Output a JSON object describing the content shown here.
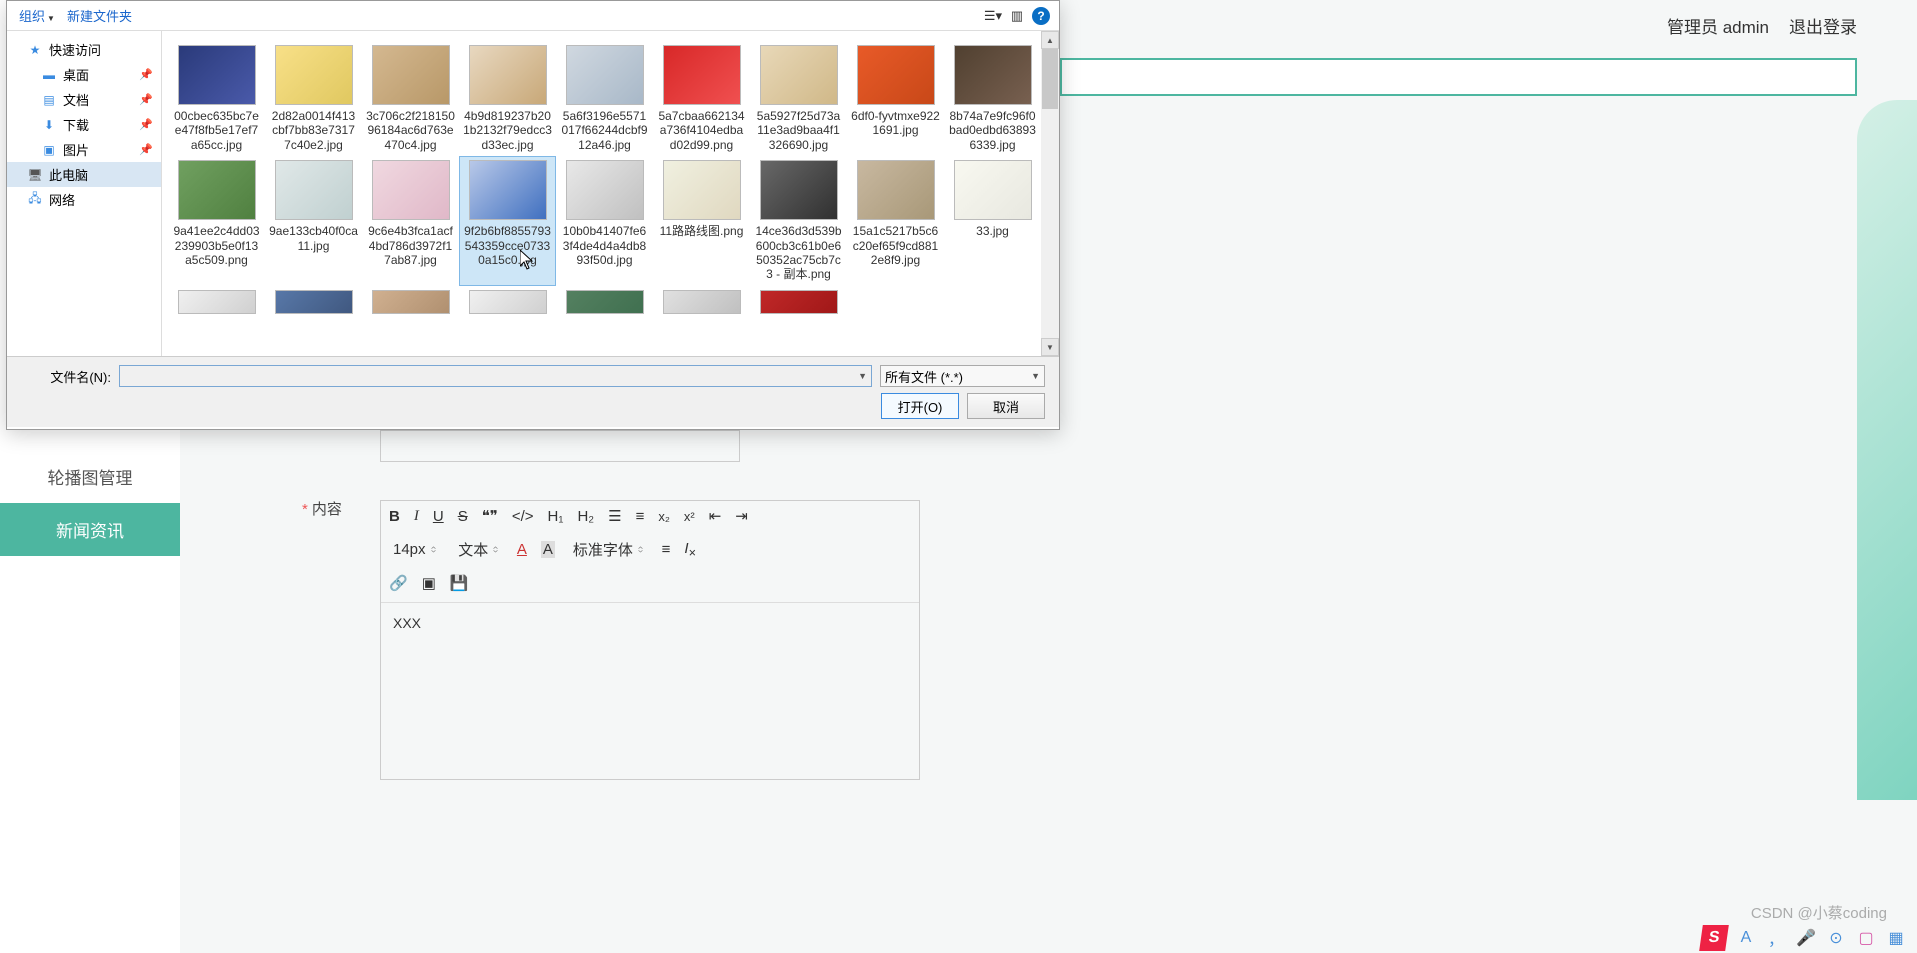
{
  "bg": {
    "admin_label": "管理员 admin",
    "logout": "退出登录",
    "sidebar": {
      "carousel": "轮播图管理",
      "news": "新闻资讯"
    },
    "content_label": "内容",
    "editor": {
      "fontsize": "14px",
      "text_type": "文本",
      "font_family": "标准字体",
      "body_text": "XXX"
    }
  },
  "dialog": {
    "organize": "组织",
    "new_folder": "新建文件夹",
    "filename_label": "文件名(N):",
    "filename_value": "",
    "filetype": "所有文件 (*.*)",
    "open_btn": "打开(O)",
    "cancel_btn": "取消",
    "sidebar": {
      "quick_access": "快速访问",
      "desktop": "桌面",
      "documents": "文档",
      "downloads": "下载",
      "pictures": "图片",
      "this_pc": "此电脑",
      "network": "网络"
    },
    "files": [
      {
        "name": "00cbec635bc7ee47f8fb5e17ef7a65cc.jpg",
        "th": "th0"
      },
      {
        "name": "2d82a0014f413cbf7bb83e73177c40e2.jpg",
        "th": "th1"
      },
      {
        "name": "3c706c2f21815096184ac6d763e470c4.jpg",
        "th": "th2"
      },
      {
        "name": "4b9d819237b201b2132f79edcc3d33ec.jpg",
        "th": "th3"
      },
      {
        "name": "5a6f3196e5571017f66244dcbf912a46.jpg",
        "th": "th4"
      },
      {
        "name": "5a7cbaa662134a736f4104edbad02d99.png",
        "th": "th5"
      },
      {
        "name": "5a5927f25d73a11e3ad9baa4f1326690.jpg",
        "th": "th6"
      },
      {
        "name": "6df0-fyvtmxe9221691.jpg",
        "th": "th7"
      },
      {
        "name": "8b74a7e9fc96f0bad0edbd638936339.jpg",
        "th": "th8"
      },
      {
        "name": "9a41ee2c4dd03239903b5e0f13a5c509.png",
        "th": "th9"
      },
      {
        "name": "9ae133cb40f0ca11.jpg",
        "th": "th10"
      },
      {
        "name": "9c6e4b3fca1acf4bd786d3972f17ab87.jpg",
        "th": "th11"
      },
      {
        "name": "9f2b6bf8855793543359cce07330a15c0.jpg",
        "th": "th12",
        "selected": true
      },
      {
        "name": "10b0b41407fe63f4de4d4a4db893f50d.jpg",
        "th": "th13"
      },
      {
        "name": "11路路线图.png",
        "th": "th14"
      },
      {
        "name": "14ce36d3d539b600cb3c61b0e650352ac75cb7c3 - 副本.png",
        "th": "th15"
      },
      {
        "name": "15a1c5217b5c6c20ef65f9cd8812e8f9.jpg",
        "th": "th16"
      },
      {
        "name": "33.jpg",
        "th": "th17"
      },
      {
        "name": "",
        "th": "th18",
        "partial": true
      },
      {
        "name": "",
        "th": "th19",
        "partial": true
      },
      {
        "name": "",
        "th": "th20",
        "partial": true
      },
      {
        "name": "",
        "th": "th21",
        "partial": true
      },
      {
        "name": "",
        "th": "th22",
        "partial": true
      },
      {
        "name": "",
        "th": "th23",
        "partial": true
      },
      {
        "name": "",
        "th": "th24",
        "partial": true
      }
    ]
  },
  "watermark": "CSDN @小蔡coding"
}
